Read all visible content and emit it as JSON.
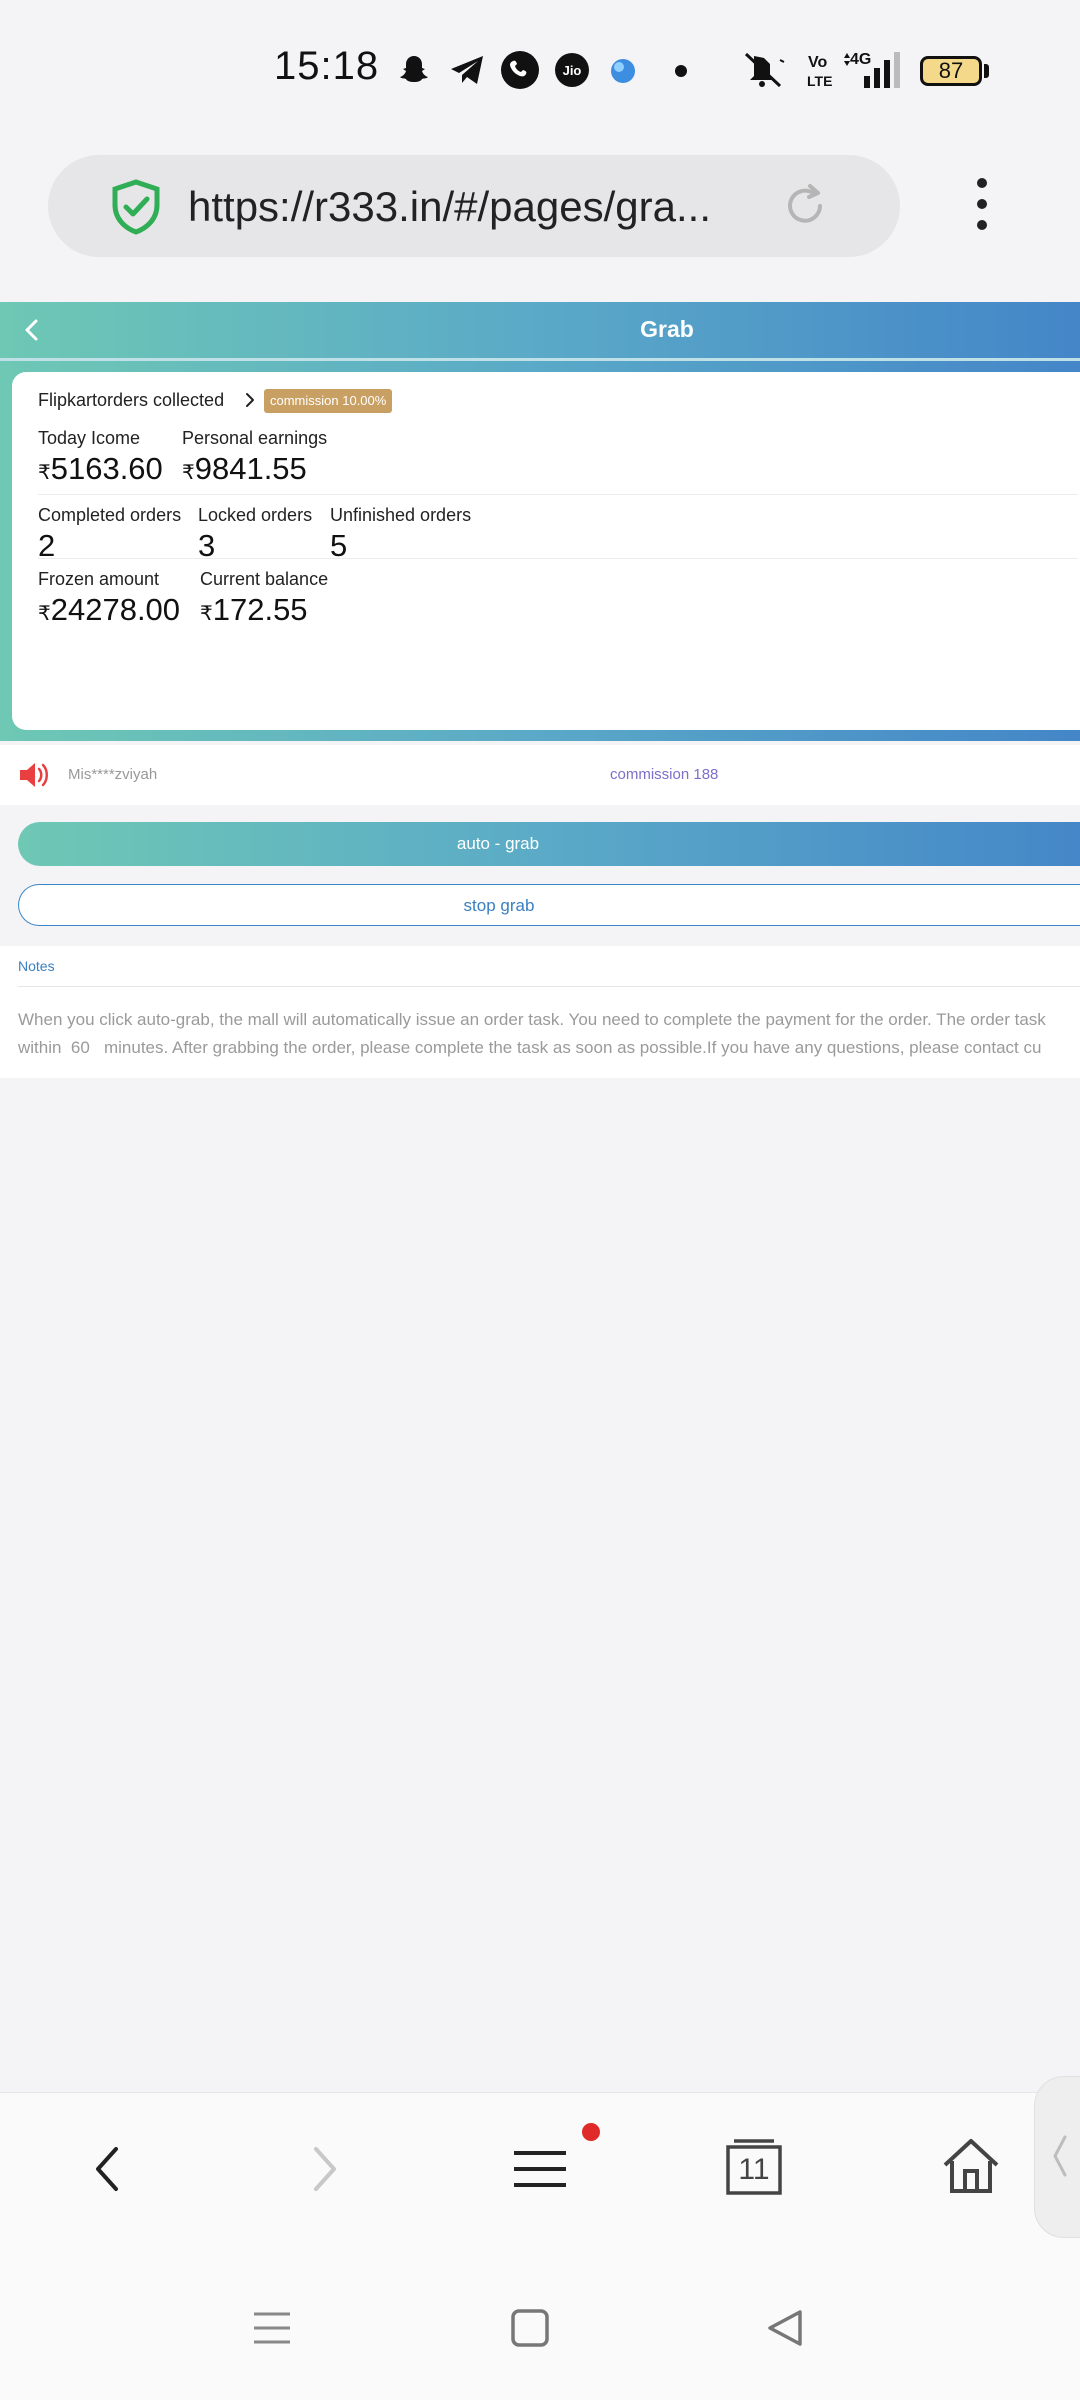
{
  "status_bar": {
    "time": "15:18",
    "battery": "87",
    "icons": [
      "snapchat-icon",
      "telegram-icon",
      "phone-icon",
      "jio-icon",
      "app-icon",
      "dot-icon",
      "mute-icon",
      "volte-icon",
      "signal-4g-icon"
    ]
  },
  "browser": {
    "url": "https://r333.in/#/pages/gra...",
    "menu_icon": "kebab-menu-icon"
  },
  "header": {
    "title": "Grab"
  },
  "card": {
    "title": "Flipkartorders collected",
    "badge": "commission 10.00%",
    "currency": "₹",
    "rows": [
      [
        {
          "label": "Today Icome",
          "value": "5163.60",
          "currency": "₹"
        },
        {
          "label": "Personal earnings",
          "value": "9841.55",
          "currency": "₹"
        }
      ],
      [
        {
          "label": "Completed orders",
          "value": "2"
        },
        {
          "label": "Locked orders",
          "value": "3"
        },
        {
          "label": "Unfinished orders",
          "value": "5"
        }
      ],
      [
        {
          "label": "Frozen amount",
          "value": "24278.00",
          "currency": "₹"
        },
        {
          "label": "Current balance",
          "value": "172.55",
          "currency": "₹"
        }
      ]
    ]
  },
  "broadcast": {
    "user": "Mis****zviyah",
    "commission": "commission 188"
  },
  "buttons": {
    "auto_grab": "auto - grab",
    "stop_grab": "stop grab"
  },
  "notes": {
    "title": "Notes",
    "line1": "When you click auto-grab, the mall will automatically issue an order task. You need to complete the payment for the order. The order task",
    "line2": "within  60   minutes. After grabbing the order, please complete the task as soon as possible.If you have any questions, please contact cu"
  },
  "bottom_nav": {
    "tabs_count": "11"
  },
  "colors": {
    "gradient_start": "#6ec8b4",
    "gradient_end": "#4486c8",
    "badge": "#c9a063",
    "link_blue": "#3a7fc0",
    "speaker_red": "#e84040",
    "notification_red": "#e02a2a"
  }
}
